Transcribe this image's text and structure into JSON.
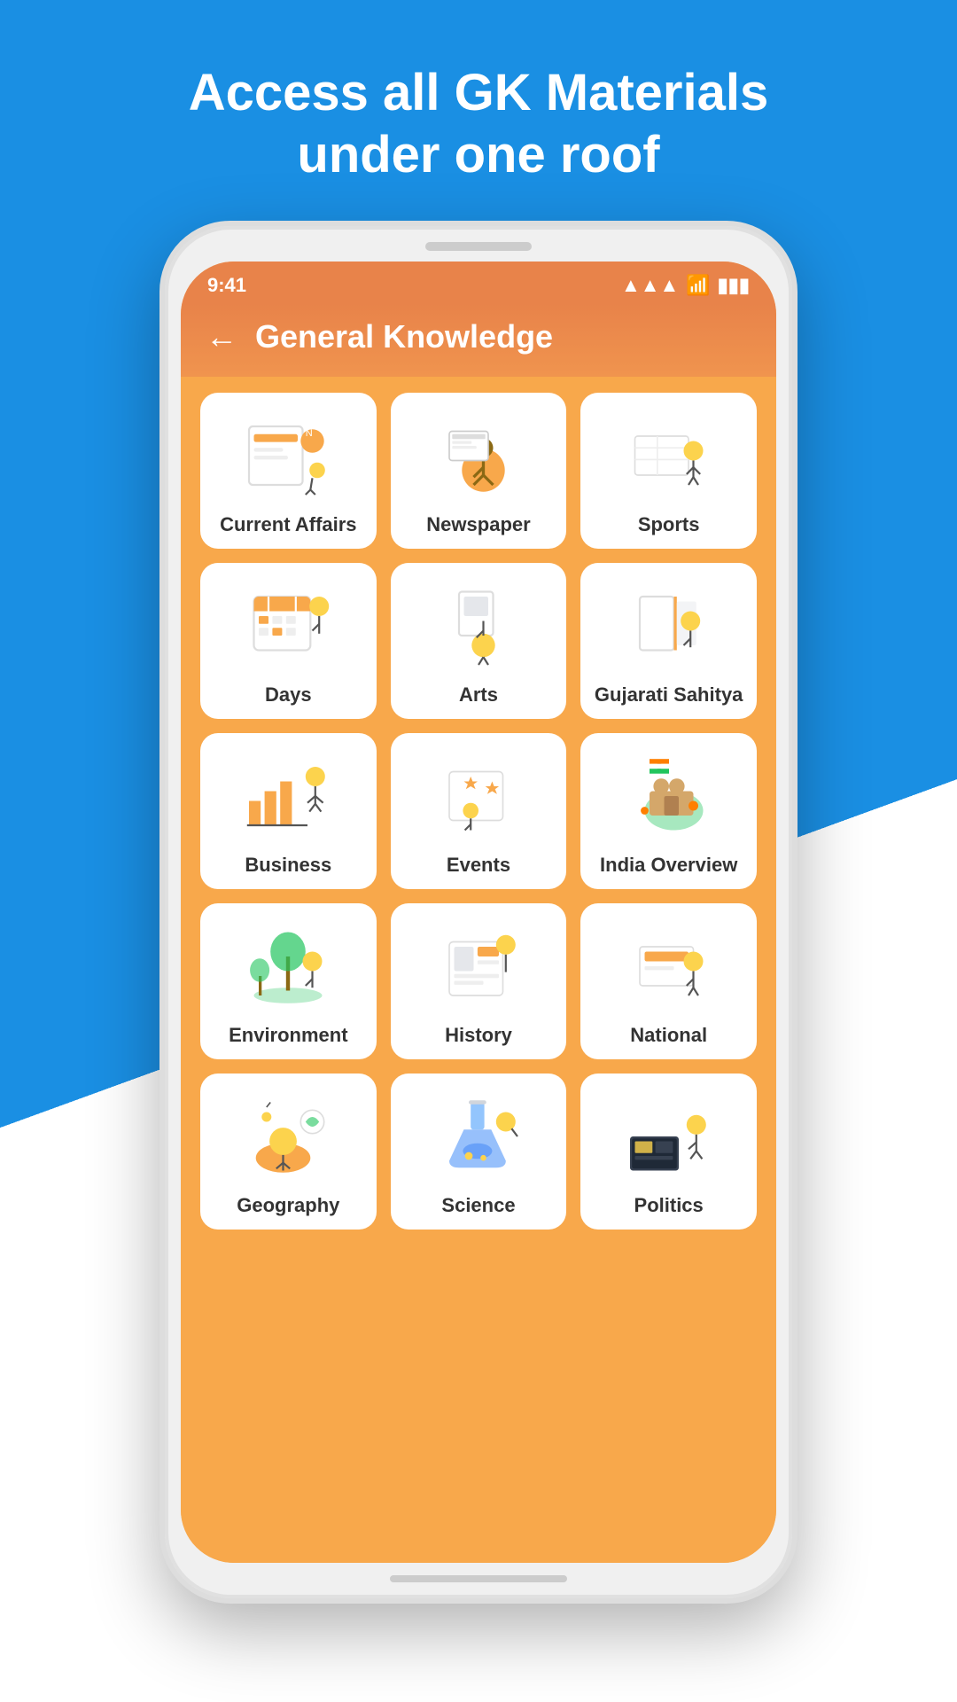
{
  "page": {
    "bg_header": "#1a8fe3",
    "headline_line1": "Access all GK Materials",
    "headline_line2": "under one roof"
  },
  "status_bar": {
    "time": "9:41",
    "signal": "▲▲▲",
    "wifi": "wifi",
    "battery": "battery"
  },
  "app": {
    "title": "General Knowledge",
    "back_label": "←"
  },
  "grid_items": [
    {
      "id": "current-affairs",
      "label": "Current Affairs",
      "icon": "news"
    },
    {
      "id": "newspaper",
      "label": "Newspaper",
      "icon": "newspaper"
    },
    {
      "id": "sports",
      "label": "Sports",
      "icon": "sports"
    },
    {
      "id": "days",
      "label": "Days",
      "icon": "days"
    },
    {
      "id": "arts",
      "label": "Arts",
      "icon": "arts"
    },
    {
      "id": "gujarati-sahitya",
      "label": "Gujarati Sahitya",
      "icon": "book"
    },
    {
      "id": "business",
      "label": "Business",
      "icon": "business"
    },
    {
      "id": "events",
      "label": "Events",
      "icon": "events"
    },
    {
      "id": "india-overview",
      "label": "India Overview",
      "icon": "india"
    },
    {
      "id": "environment",
      "label": "Environment",
      "icon": "environment"
    },
    {
      "id": "history",
      "label": "History",
      "icon": "history"
    },
    {
      "id": "national",
      "label": "National",
      "icon": "national"
    },
    {
      "id": "geography",
      "label": "Geography",
      "icon": "geography"
    },
    {
      "id": "science",
      "label": "Science",
      "icon": "science"
    },
    {
      "id": "politics",
      "label": "Politics",
      "icon": "politics"
    }
  ]
}
